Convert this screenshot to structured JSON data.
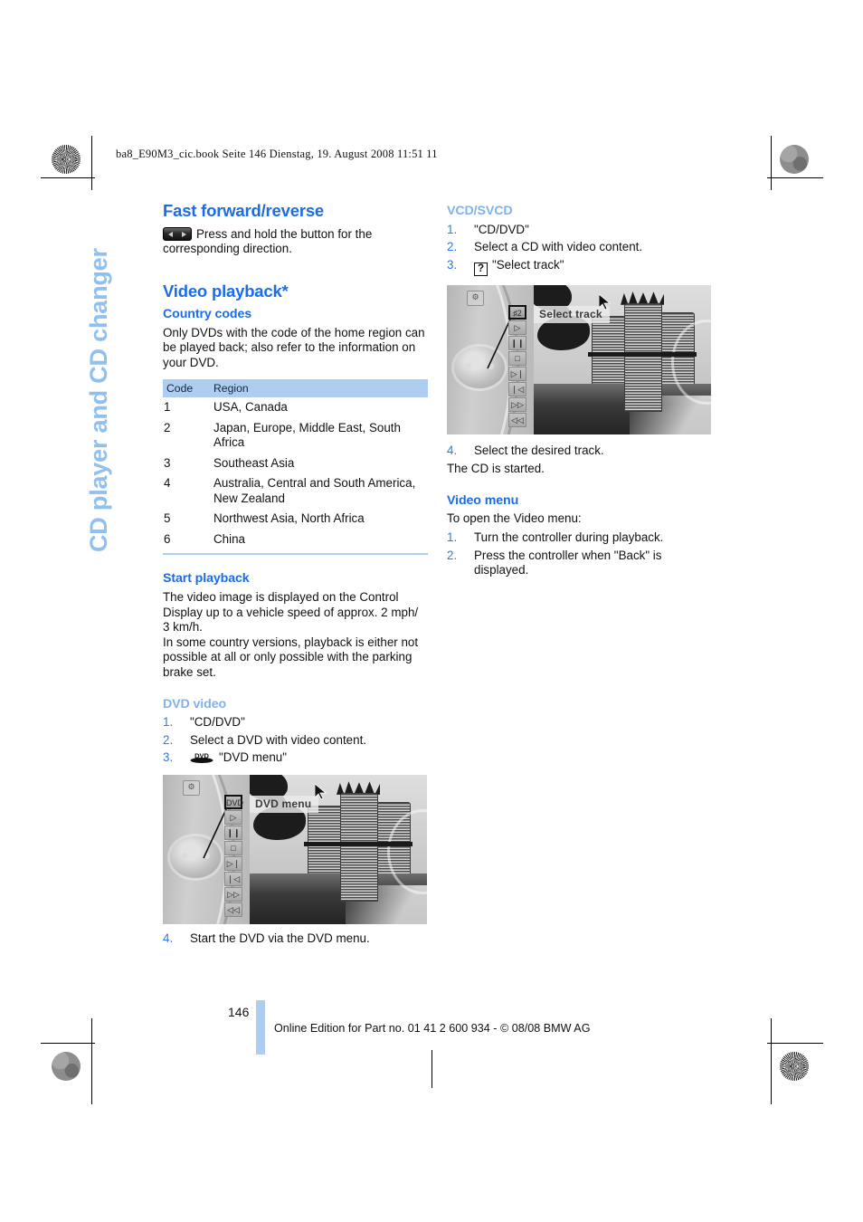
{
  "file_header": "ba8_E90M3_cic.book  Seite 146  Dienstag, 19. August 2008  11:51 11",
  "chapter_tab": "CD player and CD changer",
  "colors": {
    "heading_blue": "#1a6ce8",
    "subheading_light_blue": "#7fb3ec",
    "table_header_blue": "#aecdf0",
    "chapter_tab_blue": "#8fc0ef",
    "list_number_blue": "#2a7bea"
  },
  "left_column": {
    "fast_forward": {
      "title": "Fast forward/reverse",
      "icon": "fast-forward-reverse-button-icon",
      "text": "Press and hold the button for the corresponding direction."
    },
    "video_playback": {
      "title": "Video playback*"
    },
    "country_codes": {
      "title": "Country codes",
      "intro": "Only DVDs with the code of the home region can be played back; also refer to the information on your DVD.",
      "table": {
        "headers": [
          "Code",
          "Region"
        ],
        "rows": [
          [
            "1",
            "USA, Canada"
          ],
          [
            "2",
            "Japan, Europe, Middle East, South Africa"
          ],
          [
            "3",
            "Southeast Asia"
          ],
          [
            "4",
            "Australia, Central and South America, New Zealand"
          ],
          [
            "5",
            "Northwest Asia, North Africa"
          ],
          [
            "6",
            "China"
          ]
        ]
      }
    },
    "start_playback": {
      "title": "Start playback",
      "paragraph_1": "The video image is displayed on the Control Display up to a vehicle speed of approx. 2 mph/ 3 km/h.",
      "paragraph_2": "In some country versions, playback is either not possible at all or only possible with the parking brake set."
    },
    "dvd_video": {
      "title": "DVD video",
      "steps": [
        {
          "num": "1.",
          "text": "\"CD/DVD\"",
          "icon": ""
        },
        {
          "num": "2.",
          "text": "Select a DVD with video content.",
          "icon": ""
        },
        {
          "num": "3.",
          "text": "\"DVD menu\"",
          "icon": "dvd-logo-icon"
        },
        {
          "num": "4.",
          "text": "Start the DVD via the DVD menu.",
          "icon": ""
        }
      ],
      "screenshot": {
        "label": "DVD menu",
        "selected_icon": "dvd-menu-icon",
        "strip_icons": [
          "dvd-menu-icon",
          "play-icon",
          "pause-icon",
          "stop-icon",
          "next-track-icon",
          "previous-track-icon",
          "fast-forward-icon",
          "rewind-icon"
        ],
        "top_icon": "settings-icon"
      }
    }
  },
  "right_column": {
    "vcd_svcd": {
      "title": "VCD/SVCD",
      "steps": [
        {
          "num": "1.",
          "text": "\"CD/DVD\"",
          "icon": ""
        },
        {
          "num": "2.",
          "text": "Select a CD with video content.",
          "icon": ""
        },
        {
          "num": "3.",
          "text": "\"Select track\"",
          "icon": "question-mark-icon"
        }
      ],
      "screenshot": {
        "label": "Select track",
        "selected_icon": "select-track-icon",
        "strip_icons": [
          "select-track-icon",
          "play-icon",
          "pause-icon",
          "stop-icon",
          "next-track-icon",
          "previous-track-icon",
          "fast-forward-icon",
          "rewind-icon"
        ],
        "top_icon": "settings-icon"
      },
      "step_4": {
        "num": "4.",
        "text": "Select the desired track."
      },
      "after_text": "The CD is started."
    },
    "video_menu": {
      "title": "Video menu",
      "intro": "To open the Video menu:",
      "steps": [
        {
          "num": "1.",
          "text": "Turn the controller during playback."
        },
        {
          "num": "2.",
          "text": "Press the controller when \"Back\" is displayed."
        }
      ]
    }
  },
  "footer": {
    "page_number": "146",
    "text": "Online Edition for Part no. 01 41 2 600 934 - © 08/08 BMW AG"
  }
}
